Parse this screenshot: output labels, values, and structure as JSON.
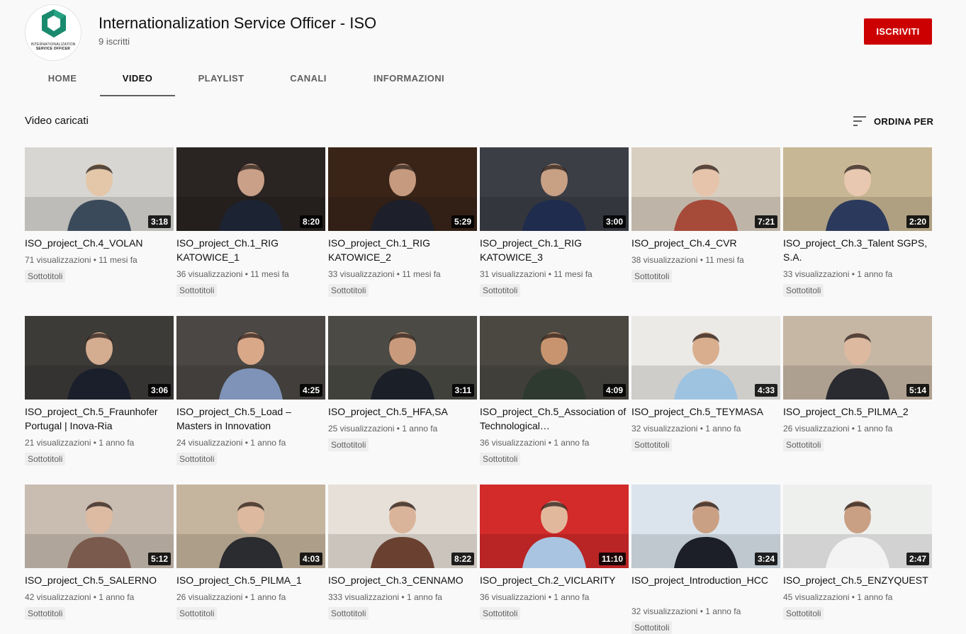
{
  "channel": {
    "logo_text_line1": "INTERNATIONALIZATION",
    "logo_text_line2": "SERVICE OFFICER",
    "logo_color": "#1a8a6e",
    "title": "Internationalization Service Officer - ISO",
    "subscribers": "9 iscritti",
    "subscribe_label": "ISCRIVITI",
    "subscribe_color": "#cc0000"
  },
  "tabs": [
    {
      "label": "HOME",
      "active": false
    },
    {
      "label": "VIDEO",
      "active": true
    },
    {
      "label": "PLAYLIST",
      "active": false
    },
    {
      "label": "CANALI",
      "active": false
    },
    {
      "label": "INFORMAZIONI",
      "active": false
    }
  ],
  "section": {
    "title": "Video caricati",
    "sort_label": "ORDINA PER",
    "sort_icon": "sort-icon"
  },
  "videos": [
    {
      "title": "ISO_project_Ch.4_VOLAN",
      "duration": "3:18",
      "views": "71 visualizzazioni",
      "age": "11 mesi fa",
      "badge": "Sottotitoli"
    },
    {
      "title": "ISO_project_Ch.1_RIG KATOWICE_1",
      "duration": "8:20",
      "views": "36 visualizzazioni",
      "age": "11 mesi fa",
      "badge": "Sottotitoli"
    },
    {
      "title": "ISO_project_Ch.1_RIG KATOWICE_2",
      "duration": "5:29",
      "views": "33 visualizzazioni",
      "age": "11 mesi fa",
      "badge": "Sottotitoli"
    },
    {
      "title": "ISO_project_Ch.1_RIG KATOWICE_3",
      "duration": "3:00",
      "views": "31 visualizzazioni",
      "age": "11 mesi fa",
      "badge": "Sottotitoli"
    },
    {
      "title": "ISO_project_Ch.4_CVR",
      "duration": "7:21",
      "views": "38 visualizzazioni",
      "age": "11 mesi fa",
      "badge": "Sottotitoli"
    },
    {
      "title": "ISO_project_Ch.3_Talent SGPS, S.A.",
      "duration": "2:20",
      "views": "33 visualizzazioni",
      "age": "1 anno fa",
      "badge": "Sottotitoli"
    },
    {
      "title": "ISO_project_Ch.5_Fraunhofer Portugal | Inova-Ria",
      "duration": "3:06",
      "views": "21 visualizzazioni",
      "age": "1 anno fa",
      "badge": "Sottotitoli"
    },
    {
      "title": "ISO_project_Ch.5_Load – Masters in Innovation",
      "duration": "4:25",
      "views": "24 visualizzazioni",
      "age": "1 anno fa",
      "badge": "Sottotitoli"
    },
    {
      "title": "ISO_project_Ch.5_HFA,SA",
      "duration": "3:11",
      "views": "25 visualizzazioni",
      "age": "1 anno fa",
      "badge": "Sottotitoli"
    },
    {
      "title": "ISO_project_Ch.5_Association of Technological…",
      "duration": "4:09",
      "views": "36 visualizzazioni",
      "age": "1 anno fa",
      "badge": "Sottotitoli"
    },
    {
      "title": "ISO_project_Ch.5_TEYMASA",
      "duration": "4:33",
      "views": "32 visualizzazioni",
      "age": "1 anno fa",
      "badge": "Sottotitoli"
    },
    {
      "title": "ISO_project_Ch.5_PILMA_2",
      "duration": "5:14",
      "views": "26 visualizzazioni",
      "age": "1 anno fa",
      "badge": "Sottotitoli"
    },
    {
      "title": "ISO_project_Ch.5_SALERNO",
      "duration": "5:12",
      "views": "42 visualizzazioni",
      "age": "1 anno fa",
      "badge": "Sottotitoli"
    },
    {
      "title": "ISO_project_Ch.5_PILMA_1",
      "duration": "4:03",
      "views": "26 visualizzazioni",
      "age": "1 anno fa",
      "badge": "Sottotitoli"
    },
    {
      "title": "ISO_project_Ch.3_CENNAMO",
      "duration": "8:22",
      "views": "333 visualizzazioni",
      "age": "1 anno fa",
      "badge": "Sottotitoli"
    },
    {
      "title": "ISO_project_Ch.2_VICLARITY",
      "duration": "11:10",
      "views": "36 visualizzazioni",
      "age": "1 anno fa",
      "badge": "Sottotitoli"
    },
    {
      "title": "ISO_project_Introduction_HCC",
      "duration": "3:24",
      "views": "32 visualizzazioni",
      "age": "1 anno fa",
      "badge": "Sottotitoli"
    },
    {
      "title": "ISO_project_Ch.5_ENZYQUEST",
      "duration": "2:47",
      "views": "45 visualizzazioni",
      "age": "1 anno fa",
      "badge": "Sottotitoli"
    }
  ]
}
